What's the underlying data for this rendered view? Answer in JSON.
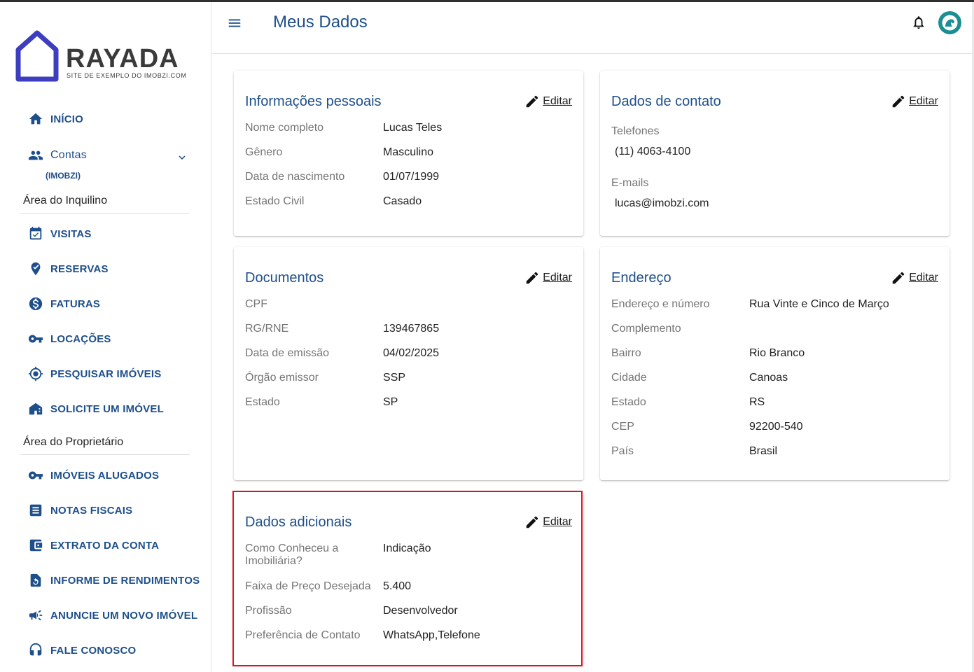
{
  "brand": {
    "name": "RAYADA",
    "tagline": "SITE DE EXEMPLO DO IMOBZI.COM"
  },
  "sidebar": {
    "inicio": "INÍCIO",
    "contas": "Contas",
    "contas_sub": "(IMOBZI)",
    "section_inquilino": "Área do Inquilino",
    "inquilino_items": [
      "VISITAS",
      "RESERVAS",
      "FATURAS",
      "LOCAÇÕES",
      "PESQUISAR IMÓVEIS",
      "SOLICITE UM IMÓVEL"
    ],
    "section_proprietario": "Área do Proprietário",
    "proprietario_items": [
      "IMÓVEIS ALUGADOS",
      "NOTAS FISCAIS",
      "EXTRATO DA CONTA",
      "INFORME DE RENDIMENTOS",
      "ANUNCIE UM NOVO IMÓVEL",
      "FALE CONOSCO"
    ]
  },
  "header": {
    "title": "Meus Dados"
  },
  "edit_label": "Editar",
  "personal": {
    "title": "Informações pessoais",
    "rows": [
      {
        "label": "Nome completo",
        "value": "Lucas Teles"
      },
      {
        "label": "Gênero",
        "value": "Masculino"
      },
      {
        "label": "Data de nascimento",
        "value": "01/07/1999"
      },
      {
        "label": "Estado Civil",
        "value": "Casado"
      }
    ]
  },
  "contact": {
    "title": "Dados de contato",
    "phones_label": "Telefones",
    "phone": "(11) 4063-4100",
    "emails_label": "E-mails",
    "email": "lucas@imobzi.com"
  },
  "documents": {
    "title": "Documentos",
    "rows": [
      {
        "label": "CPF",
        "value": ""
      },
      {
        "label": "RG/RNE",
        "value": "139467865"
      },
      {
        "label": "Data de emissão",
        "value": "04/02/2025"
      },
      {
        "label": "Órgão emissor",
        "value": "SSP"
      },
      {
        "label": "Estado",
        "value": "SP"
      }
    ]
  },
  "address": {
    "title": "Endereço",
    "rows": [
      {
        "label": "Endereço e número",
        "value": "Rua Vinte e Cinco de Março"
      },
      {
        "label": "Complemento",
        "value": ""
      },
      {
        "label": "Bairro",
        "value": "Rio Branco"
      },
      {
        "label": "Cidade",
        "value": "Canoas"
      },
      {
        "label": "Estado",
        "value": "RS"
      },
      {
        "label": "CEP",
        "value": "92200-540"
      },
      {
        "label": "País",
        "value": "Brasil"
      }
    ]
  },
  "additional": {
    "title": "Dados adicionais",
    "rows": [
      {
        "label": "Como Conheceu a Imobiliária?",
        "value": "Indicação"
      },
      {
        "label": "Faixa de Preço Desejada",
        "value": "5.400"
      },
      {
        "label": "Profissão",
        "value": "Desenvolvedor"
      },
      {
        "label": "Preferência de Contato",
        "value": "WhatsApp,Telefone"
      }
    ]
  },
  "colors": {
    "primary": "#1e4f8a",
    "highlight": "#e0141e",
    "logo": "#3d3dbf"
  }
}
